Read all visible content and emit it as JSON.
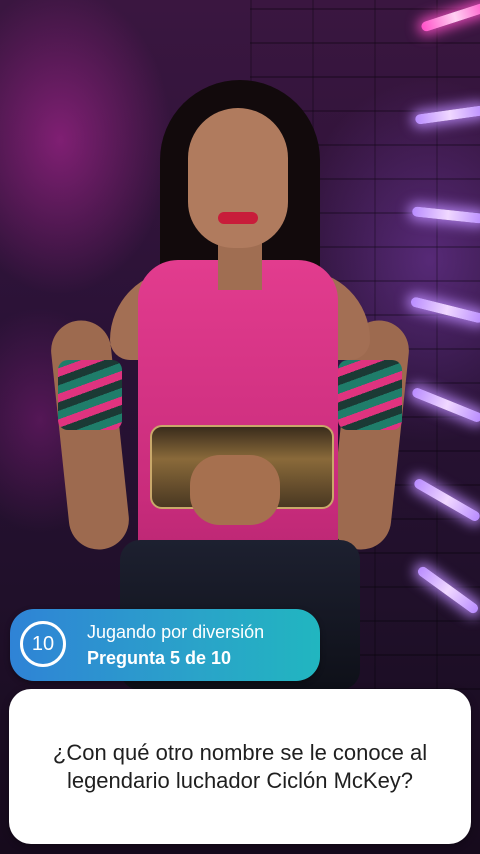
{
  "quiz": {
    "timer_value": "10",
    "mode_label": "Jugando por diversión",
    "progress_label": "Pregunta 5 de 10",
    "question": "¿Con qué otro nombre se le conoce al legendario luchador Ciclón McKey?"
  },
  "colors": {
    "pill_gradient_start": "#2f83d6",
    "pill_gradient_end": "#21b6c0",
    "card_background": "#ffffff",
    "question_text": "#1f1f1f"
  },
  "icons": {
    "timer": "circular-countdown-timer"
  }
}
